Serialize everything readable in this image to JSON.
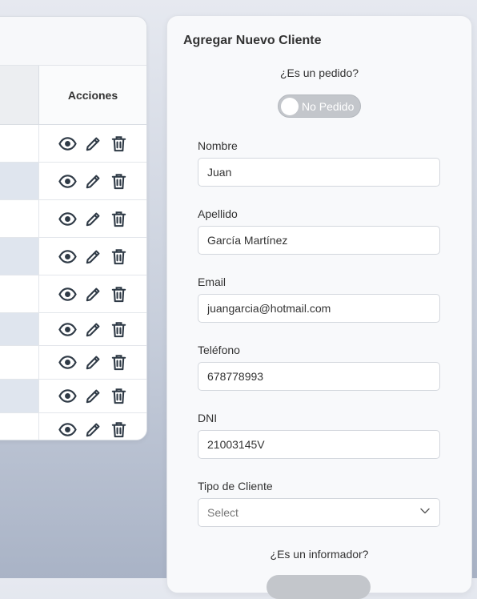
{
  "table": {
    "actions_header": "Acciones",
    "row_count": 9,
    "row_heights": [
      46,
      46,
      46,
      46,
      46,
      40,
      41,
      41,
      41
    ],
    "row_shading": [
      "plain",
      "alt",
      "plain",
      "alt",
      "plain",
      "alt",
      "plain",
      "alt",
      "plain"
    ],
    "actions": [
      "view-icon",
      "edit-icon",
      "delete-icon"
    ]
  },
  "form": {
    "title": "Agregar Nuevo Cliente",
    "pedido_question": "¿Es un pedido?",
    "pedido_toggle_label": "No Pedido",
    "fields": {
      "nombre": {
        "label": "Nombre",
        "value": "Juan"
      },
      "apellido": {
        "label": "Apellido",
        "value": "García Martínez"
      },
      "email": {
        "label": "Email",
        "value": "juangarcia@hotmail.com"
      },
      "telefono": {
        "label": "Teléfono",
        "value": "678778993"
      },
      "dni": {
        "label": "DNI",
        "value": "21003145V"
      }
    },
    "tipo_cliente": {
      "label": "Tipo de Cliente",
      "placeholder": "Select"
    },
    "informador_question": "¿Es un informador?"
  },
  "colors": {
    "icon": "#2f3a46",
    "row_alt": "#dfe5ee",
    "toggle_off": "#c3c6cb"
  }
}
